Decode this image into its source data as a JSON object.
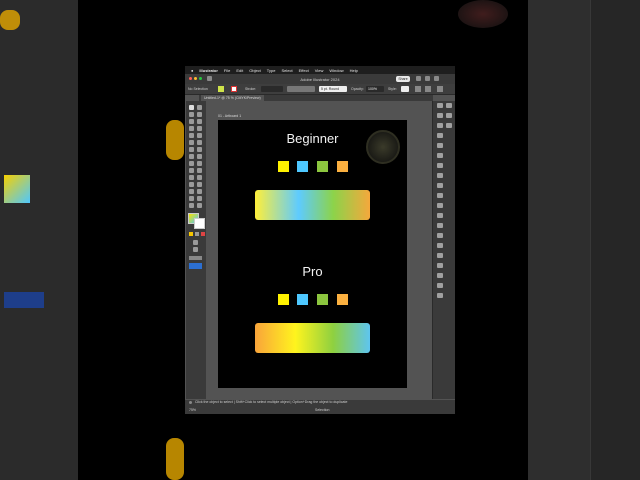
{
  "menubar": {
    "apple": "",
    "app_name": "Illustrator",
    "items": [
      "File",
      "Edit",
      "Object",
      "Type",
      "Select",
      "Effect",
      "View",
      "Window",
      "Help"
    ]
  },
  "window": {
    "title": "Adobe Illustrator 2024",
    "share_label": "Share"
  },
  "control_bar": {
    "selection_label": "No Selection",
    "stroke_label": "Stroke:",
    "style_label": "5 pt. Round",
    "opacity_label": "Opacity:",
    "opacity_value": "100%",
    "style_field": "Style:"
  },
  "document_tab": {
    "label": "Untitled-1* @ 75 % (CMYK/Preview)"
  },
  "artboard": {
    "label": "01 - Artboard 1",
    "sections": [
      {
        "heading": "Beginner",
        "swatches": [
          "#fff200",
          "#4ec8ff",
          "#8cc63f",
          "#fbb040"
        ],
        "gradient": [
          "#ffef3a",
          "#5ecbff",
          "#8cd34a",
          "#f5a83c"
        ]
      },
      {
        "heading": "Pro",
        "swatches": [
          "#fff200",
          "#4ec8ff",
          "#8cc63f",
          "#fbb040"
        ],
        "gradient": [
          "#f9a43a",
          "#fff41e",
          "#8ed040",
          "#5ec5f0"
        ]
      }
    ]
  },
  "statusbar": {
    "zoom": "75%",
    "hint": "Click the object to select  |  Shift+Click to select multiple object  |  Option+Drag the object to duplicate",
    "tool": "Selection"
  },
  "colors": {
    "app_bg": "#535353",
    "panel": "#3a3a3a",
    "canvas": "#000000"
  }
}
